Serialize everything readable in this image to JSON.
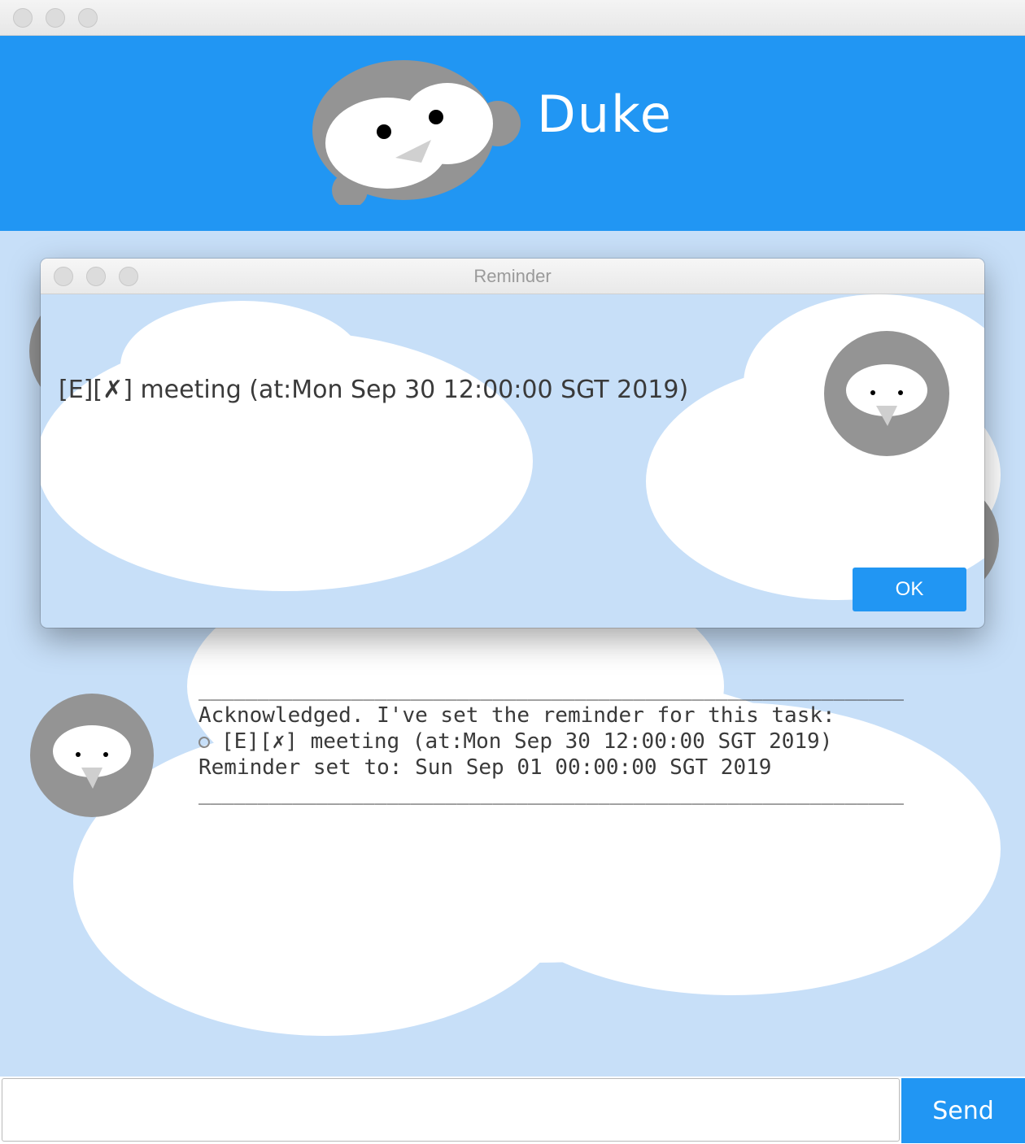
{
  "app": {
    "title": "Duke"
  },
  "reminder_dialog": {
    "title": "Reminder",
    "message": "[E][✗] meeting (at:Mon Sep 30 12:00:00 SGT 2019)",
    "ok_label": "OK"
  },
  "conversation": {
    "bot_message": {
      "separator_top": "____________________________________________________________",
      "line1": "Acknowledged. I've set the reminder for this task:",
      "line2": "[E][✗] meeting (at:Mon Sep 30 12:00:00 SGT 2019)",
      "line3": "Reminder set to: Sun Sep 01 00:00:00 SGT 2019",
      "separator_bottom": "____________________________________________________________"
    }
  },
  "input": {
    "value": "",
    "placeholder": ""
  },
  "send_label": "Send",
  "colors": {
    "accent": "#2196f3",
    "chat_background": "#c7dff8",
    "avatar_gray": "#949494"
  },
  "icons": {
    "logo": "duke-owl-icon",
    "avatar": "owl-avatar-icon",
    "alarm": "alarm-clock-icon"
  }
}
